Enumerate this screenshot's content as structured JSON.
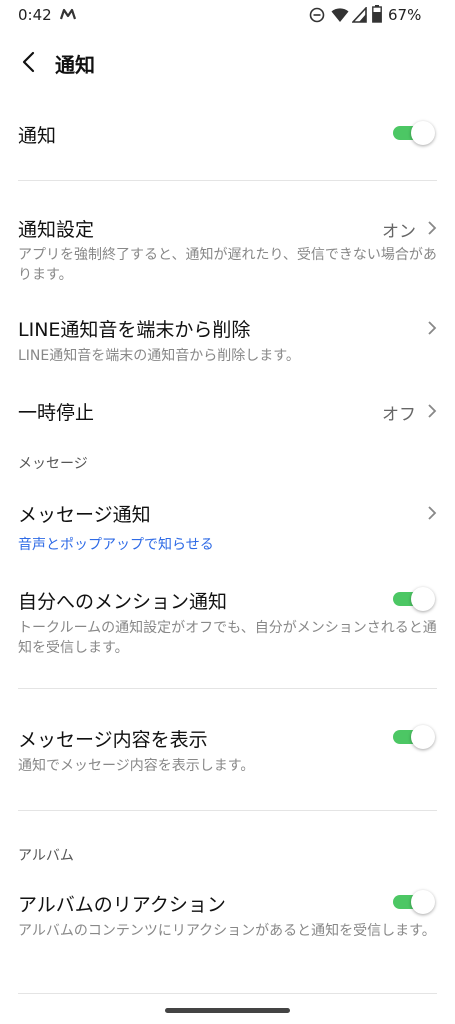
{
  "status_bar": {
    "time": "0:42",
    "battery": "67%"
  },
  "header": {
    "title": "通知"
  },
  "notifications": {
    "label": "通知",
    "enabled": true
  },
  "notification_settings": {
    "label": "通知設定",
    "value": "オン",
    "description": "アプリを強制終了すると、通知が遅れたり、受信できない場合があります。"
  },
  "delete_sound": {
    "label": "LINE通知音を端末から削除",
    "description": "LINE通知音を端末の通知音から削除します。"
  },
  "pause": {
    "label": "一時停止",
    "value": "オフ"
  },
  "message_section": {
    "header": "メッセージ",
    "message_notification": {
      "label": "メッセージ通知",
      "sublabel": "音声とポップアップで知らせる"
    },
    "mention": {
      "label": "自分へのメンション通知",
      "description": "トークルームの通知設定がオフでも、自分がメンションされると通知を受信します。",
      "enabled": true
    },
    "show_content": {
      "label": "メッセージ内容を表示",
      "description": "通知でメッセージ内容を表示します。",
      "enabled": true
    }
  },
  "album_section": {
    "header": "アルバム",
    "reaction": {
      "label": "アルバムのリアクション",
      "description": "アルバムのコンテンツにリアクションがあると通知を受信します。",
      "enabled": true
    }
  },
  "colors": {
    "toggle_on": "#4cc764",
    "link": "#2f6be6"
  },
  "icons": [
    "app-m-icon",
    "dnd-icon",
    "wifi-icon",
    "cell-signal-icon",
    "battery-icon",
    "back-arrow-icon",
    "chevron-right-icon"
  ]
}
